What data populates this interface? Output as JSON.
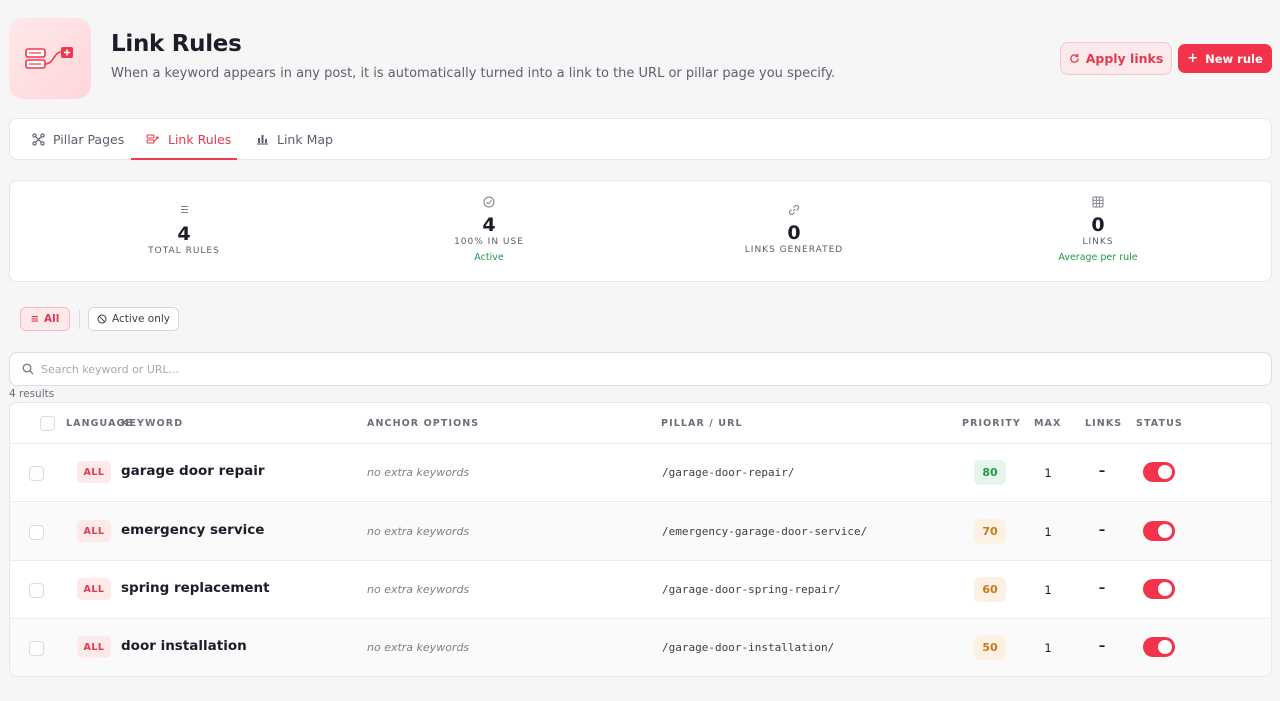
{
  "header": {
    "title": "Link Rules",
    "subtitle": "When a keyword appears in any post, it is automatically turned into a link to the URL or pillar page you specify.",
    "apply_label": "Apply links",
    "new_rule_label": "New rule"
  },
  "tabs": [
    {
      "label": "Pillar Pages",
      "icon": "nodes-icon",
      "active": false
    },
    {
      "label": "Link Rules",
      "icon": "link-rule-icon",
      "active": true
    },
    {
      "label": "Link Map",
      "icon": "bar-chart-icon",
      "active": false
    }
  ],
  "stats": [
    {
      "icon": "list-icon",
      "value": "4",
      "label": "TOTAL RULES",
      "sub": ""
    },
    {
      "icon": "check-circle-icon",
      "value": "4",
      "label": "100% IN USE",
      "sub": "Active"
    },
    {
      "icon": "link-icon",
      "value": "0",
      "label": "LINKS GENERATED",
      "sub": ""
    },
    {
      "icon": "grid-icon",
      "value": "0",
      "label": "LINKS",
      "sub": "Average per rule"
    }
  ],
  "filters": {
    "all_label": "All",
    "active_label": "Active only"
  },
  "search": {
    "placeholder": "Search keyword or URL...",
    "value": ""
  },
  "results_count": "4 results",
  "table": {
    "headers": {
      "language": "LANGUAGE",
      "keyword": "KEYWORD",
      "anchor": "ANCHOR OPTIONS",
      "url": "PILLAR / URL",
      "priority": "PRIORITY",
      "max": "MAX",
      "links": "LINKS",
      "status": "STATUS"
    },
    "rows": [
      {
        "language": "ALL",
        "keyword": "garage door repair",
        "anchor": "no extra keywords",
        "url": "/garage-door-repair/",
        "priority": "80",
        "max": "1",
        "links": "–",
        "status": "on"
      },
      {
        "language": "ALL",
        "keyword": "emergency service",
        "anchor": "no extra keywords",
        "url": "/emergency-garage-door-service/",
        "priority": "70",
        "max": "1",
        "links": "–",
        "status": "on"
      },
      {
        "language": "ALL",
        "keyword": "spring replacement",
        "anchor": "no extra keywords",
        "url": "/garage-door-spring-repair/",
        "priority": "60",
        "max": "1",
        "links": "–",
        "status": "on"
      },
      {
        "language": "ALL",
        "keyword": "door installation",
        "anchor": "no extra keywords",
        "url": "/garage-door-installation/",
        "priority": "50",
        "max": "1",
        "links": "–",
        "status": "on"
      }
    ]
  },
  "colors": {
    "accent": "#f2334b",
    "success": "#1f9a4a",
    "warning": "#c9781b"
  }
}
